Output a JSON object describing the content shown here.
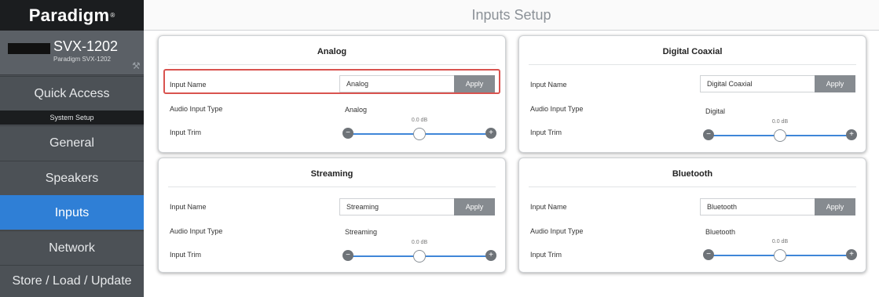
{
  "sidebar": {
    "logo": "Paradigm",
    "logo_mark": "®",
    "device_name": "SVX-1202",
    "device_model": "Paradigm SVX-1202",
    "items": {
      "quick_access": "Quick Access",
      "section_header": "System Setup",
      "general": "General",
      "speakers": "Speakers",
      "inputs": "Inputs",
      "network": "Network",
      "store": "Store / Load / Update"
    },
    "active_item": "Inputs",
    "active_color": "#2f7fd6"
  },
  "header": {
    "title": "Inputs Setup"
  },
  "labels": {
    "input_name": "Input Name",
    "audio_input_type": "Audio Input Type",
    "input_trim": "Input Trim",
    "apply": "Apply"
  },
  "cards": {
    "analog": {
      "title": "Analog",
      "name_value": "Analog",
      "audio_type": "Analog",
      "trim_label": "0.0 dB",
      "trim_level": 0.5,
      "highlighted": true
    },
    "digital": {
      "title": "Digital Coaxial",
      "name_value": "Digital Coaxial",
      "audio_type": "Digital",
      "trim_label": "0.0 dB",
      "trim_level": 0.5
    },
    "streaming": {
      "title": "Streaming",
      "name_value": "Streaming",
      "audio_type": "Streaming",
      "trim_label": "0.0 dB",
      "trim_level": 0.5
    },
    "bluetooth": {
      "title": "Bluetooth",
      "name_value": "Bluetooth",
      "audio_type": "Bluetooth",
      "trim_label": "0.0 dB",
      "trim_level": 0.5
    }
  },
  "colors": {
    "highlight": "#d9534f",
    "slider_track": "#3f86d8",
    "apply_button": "#868b90"
  }
}
